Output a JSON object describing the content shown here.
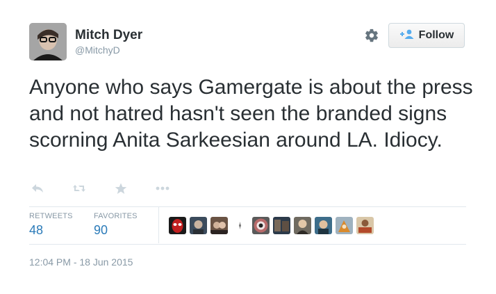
{
  "author": {
    "name": "Mitch Dyer",
    "handle": "@MitchyD"
  },
  "follow_button": {
    "label": "Follow"
  },
  "tweet": {
    "text": "Anyone who says Gamergate is about the press and not hatred hasn't seen the branded signs scorning Anita Sarkeesian around LA. Idiocy."
  },
  "actions": [
    "reply-icon",
    "retweet-icon",
    "favorite-icon",
    "more-icon"
  ],
  "stats": {
    "retweets_label": "RETWEETS",
    "retweets_count": "48",
    "favorites_label": "FAVORITES",
    "favorites_count": "90"
  },
  "timestamp": "12:04 PM - 18 Jun 2015",
  "colors": {
    "text": "#292f33",
    "muted": "#8899a6",
    "link_blue": "#2b7bb9",
    "follow_icon_blue": "#55acee",
    "icon_gray": "#ccd6dd"
  }
}
